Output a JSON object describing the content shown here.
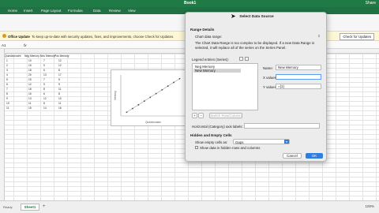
{
  "window": {
    "title": "Book1",
    "share_label": "Share"
  },
  "ribbon": {
    "tabs": [
      "Home",
      "Insert",
      "Page Layout",
      "Formulas",
      "Data",
      "Review",
      "View"
    ]
  },
  "update_bar": {
    "label": "Office Update",
    "message": "To keep up-to-date with security updates, fixes, and improvements, choose Check for Updates.",
    "button": "Check for Updates"
  },
  "formula_bar": {
    "name_box": "A1",
    "fx": "fx"
  },
  "sheet": {
    "headers": [
      "Questionnaire",
      "Neg Memory",
      "Neu Memory",
      "Pos Memory"
    ],
    "rows": [
      [
        "1",
        "10",
        "7",
        "12"
      ],
      [
        "2",
        "15",
        "9",
        "12"
      ],
      [
        "3",
        "18",
        "6",
        "8"
      ],
      [
        "4",
        "20",
        "13",
        "17"
      ],
      [
        "5",
        "15",
        "7",
        "5"
      ],
      [
        "6",
        "12",
        "9",
        "9"
      ],
      [
        "7",
        "18",
        "8",
        "11"
      ],
      [
        "8",
        "16",
        "6",
        "8"
      ],
      [
        "9",
        "13",
        "12",
        "10"
      ],
      [
        "10",
        "11",
        "8",
        "11"
      ],
      [
        "11",
        "15",
        "14",
        "16"
      ]
    ]
  },
  "chart_data": {
    "type": "scatter",
    "xlabel": "Questionnaire",
    "ylabel": "Memory",
    "x": [
      1,
      2,
      3,
      4,
      5,
      6,
      7,
      8,
      9,
      10
    ],
    "series": [
      {
        "values": [
          1,
          2,
          3,
          4,
          5,
          6,
          7,
          8,
          9,
          10
        ]
      }
    ],
    "trendline": true
  },
  "bottom": {
    "sheet_tab": "Sheet1",
    "add_sheet": "+",
    "status": "Ready",
    "zoom": "100%"
  },
  "dialog": {
    "title": "Select Data Source",
    "range_section": "Range Details",
    "chart_range_label": "Chart data range:",
    "range_message": "The Chart Data Range is too complex to be displayed. If a new Data Range is selected, it will replace all of the series on the Series Panel.",
    "legend_label": "Legend entries (Series):",
    "series_items": [
      "Neg Memory",
      "New Memory"
    ],
    "switch_label": "Switch Row/Column",
    "name_label": "Name:",
    "name_value": "New Memory",
    "x_label": "X values:",
    "x_value": "",
    "y_label": "Y values:",
    "y_value": "={1}",
    "h_axis_label": "Horizontal (Category) axis labels:",
    "hidden_section": "Hidden and Empty Cells",
    "empty_label": "Show empty cells as:",
    "empty_value": "Gaps",
    "show_hidden": "Show data in hidden rows and columns",
    "cancel": "Cancel",
    "ok": "OK",
    "add": "+",
    "remove": "−"
  }
}
